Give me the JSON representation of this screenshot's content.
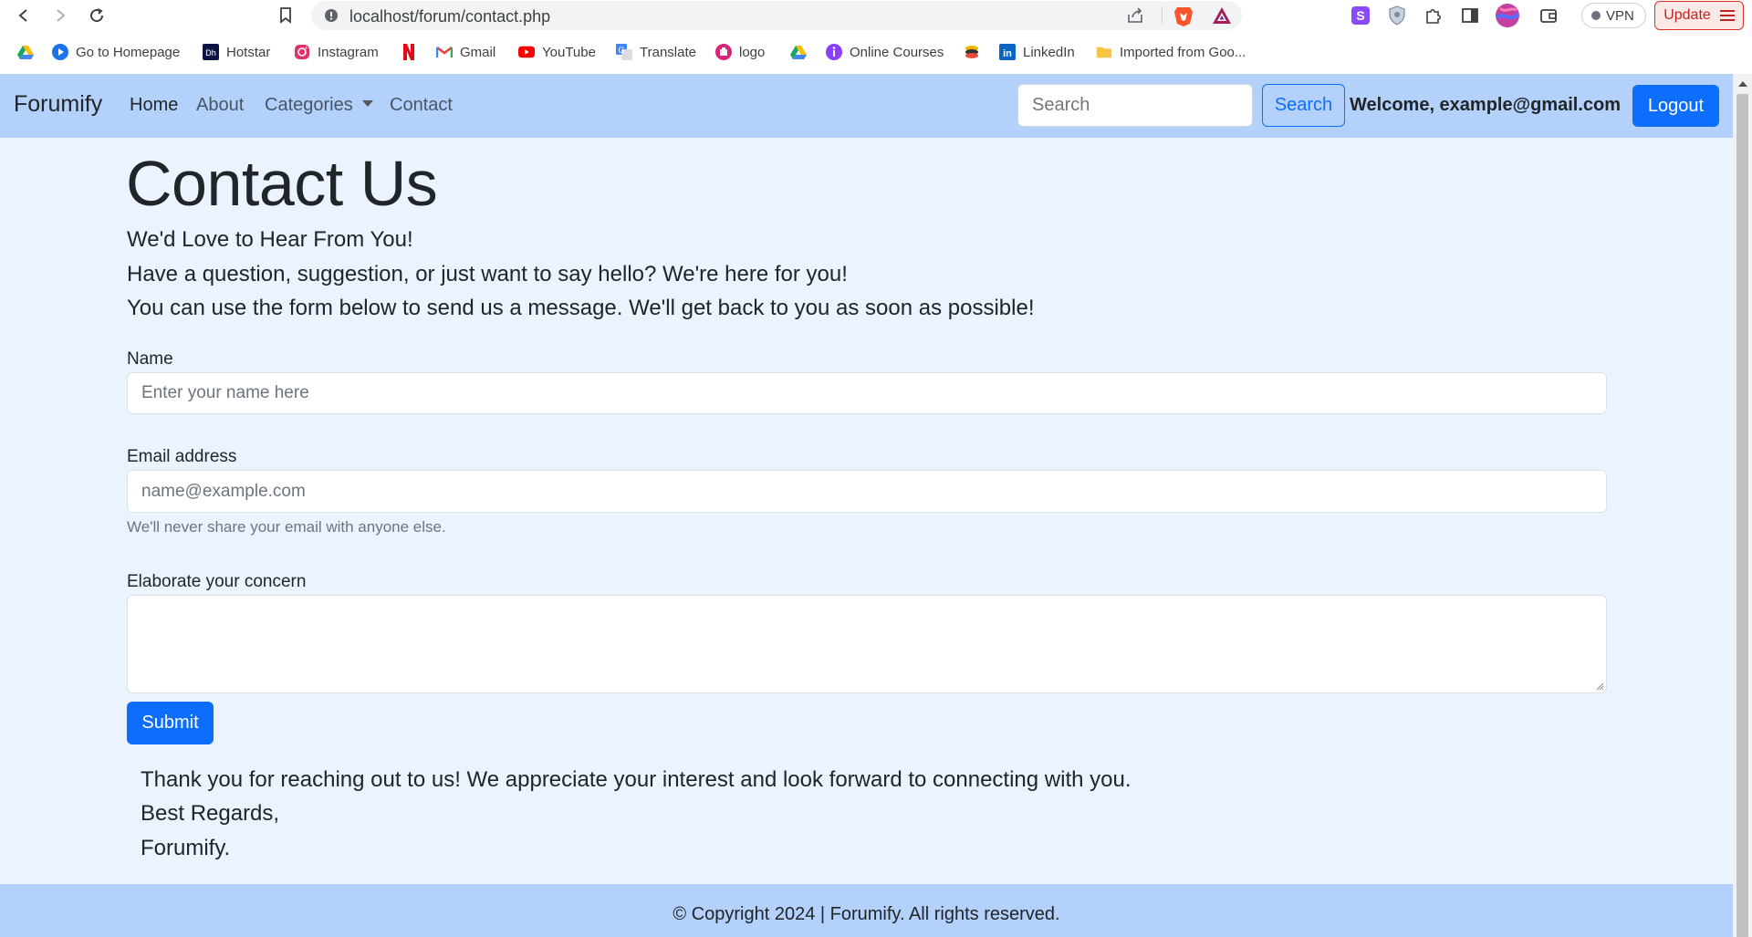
{
  "browser": {
    "url": "localhost/forum/contact.php",
    "vpn_label": "VPN",
    "update_label": "Update",
    "bookmarks": [
      {
        "label": "",
        "icon": "google-drive-icon"
      },
      {
        "label": "Go to Homepage",
        "icon": "play-circle-icon"
      },
      {
        "label": "Hotstar",
        "icon": "hotstar-icon"
      },
      {
        "label": "Instagram",
        "icon": "instagram-icon"
      },
      {
        "label": "",
        "icon": "netflix-icon"
      },
      {
        "label": "Gmail",
        "icon": "gmail-icon"
      },
      {
        "label": "YouTube",
        "icon": "youtube-icon"
      },
      {
        "label": "Translate",
        "icon": "translate-icon"
      },
      {
        "label": "logo",
        "icon": "logo-icon"
      },
      {
        "label": "",
        "icon": "google-drive-icon"
      },
      {
        "label": "Online Courses",
        "icon": "courses-icon"
      },
      {
        "label": "",
        "icon": "stack-icon"
      },
      {
        "label": "LinkedIn",
        "icon": "linkedin-icon"
      },
      {
        "label": "Imported from Goo...",
        "icon": "folder-icon"
      }
    ]
  },
  "navbar": {
    "brand": "Forumify",
    "links": [
      "Home",
      "About",
      "Categories",
      "Contact"
    ],
    "search_placeholder": "Search",
    "search_button": "Search",
    "welcome": "Welcome, example@gmail.com",
    "logout": "Logout"
  },
  "main": {
    "title": "Contact Us",
    "intro": [
      "We'd Love to Hear From You!",
      "Have a question, suggestion, or just want to say hello? We're here for you!",
      "You can use the form below to send us a message. We'll get back to you as soon as possible!"
    ],
    "form": {
      "name_label": "Name",
      "name_placeholder": "Enter your name here",
      "email_label": "Email address",
      "email_placeholder": "name@example.com",
      "email_help": "We'll never share your email with anyone else.",
      "concern_label": "Elaborate your concern",
      "submit": "Submit"
    },
    "closing": [
      "Thank you for reaching out to us! We appreciate your interest and look forward to connecting with you.",
      "Best Regards,",
      "Forumify."
    ]
  },
  "footer": {
    "text": "© Copyright 2024 | Forumify. All rights reserved."
  },
  "colors": {
    "navbar_bg": "#b3d1fb",
    "page_bg": "#ebf3ff",
    "primary": "#0d6efd"
  }
}
